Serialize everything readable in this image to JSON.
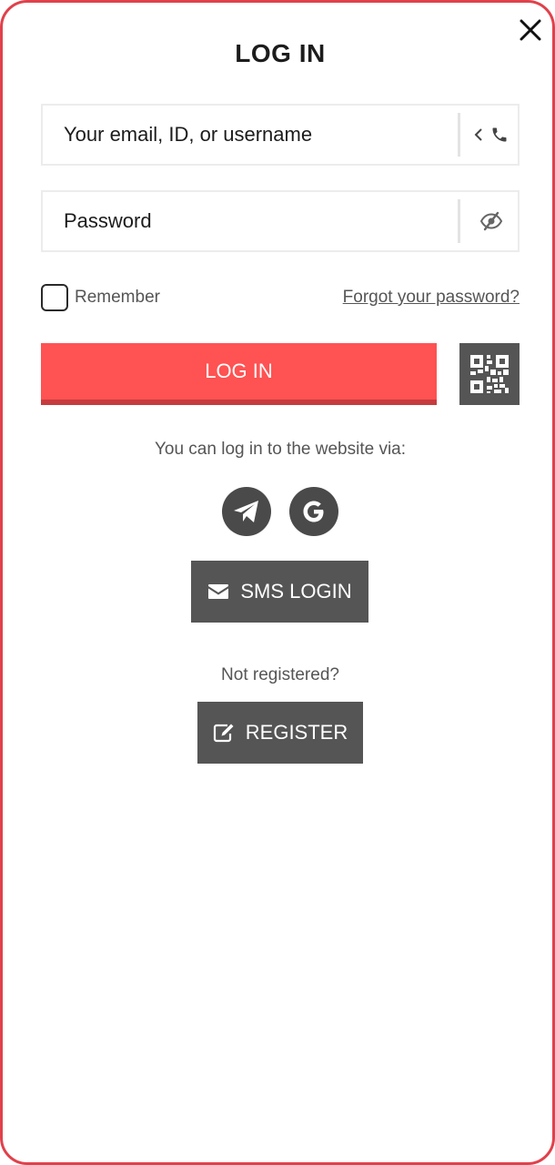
{
  "dialog": {
    "title": "LOG IN",
    "close_icon": "close-icon"
  },
  "login_field": {
    "placeholder": "Your email, ID, or username",
    "value": "",
    "toggle_icon": "chevron-left-icon",
    "phone_icon": "phone-icon"
  },
  "password_field": {
    "placeholder": "Password",
    "value": "",
    "visibility_icon": "eye-slash-icon"
  },
  "remember": {
    "label": "Remember",
    "checked": false
  },
  "forgot_link": "Forgot your password?",
  "login_button": "LOG IN",
  "qr_button_icon": "qr-code-icon",
  "social": {
    "caption": "You can log in to the website via:",
    "providers": [
      {
        "icon": "telegram-icon"
      },
      {
        "icon": "google-icon"
      }
    ]
  },
  "sms_button": {
    "label": "SMS LOGIN",
    "icon": "envelope-icon"
  },
  "register": {
    "caption": "Not registered?",
    "label": "REGISTER",
    "icon": "edit-icon"
  },
  "colors": {
    "accent": "#ff5252",
    "accent_shadow": "#c63b3f",
    "frame_border": "#e0414b",
    "dark_button": "#555555",
    "social_button": "#4a4a4a"
  }
}
